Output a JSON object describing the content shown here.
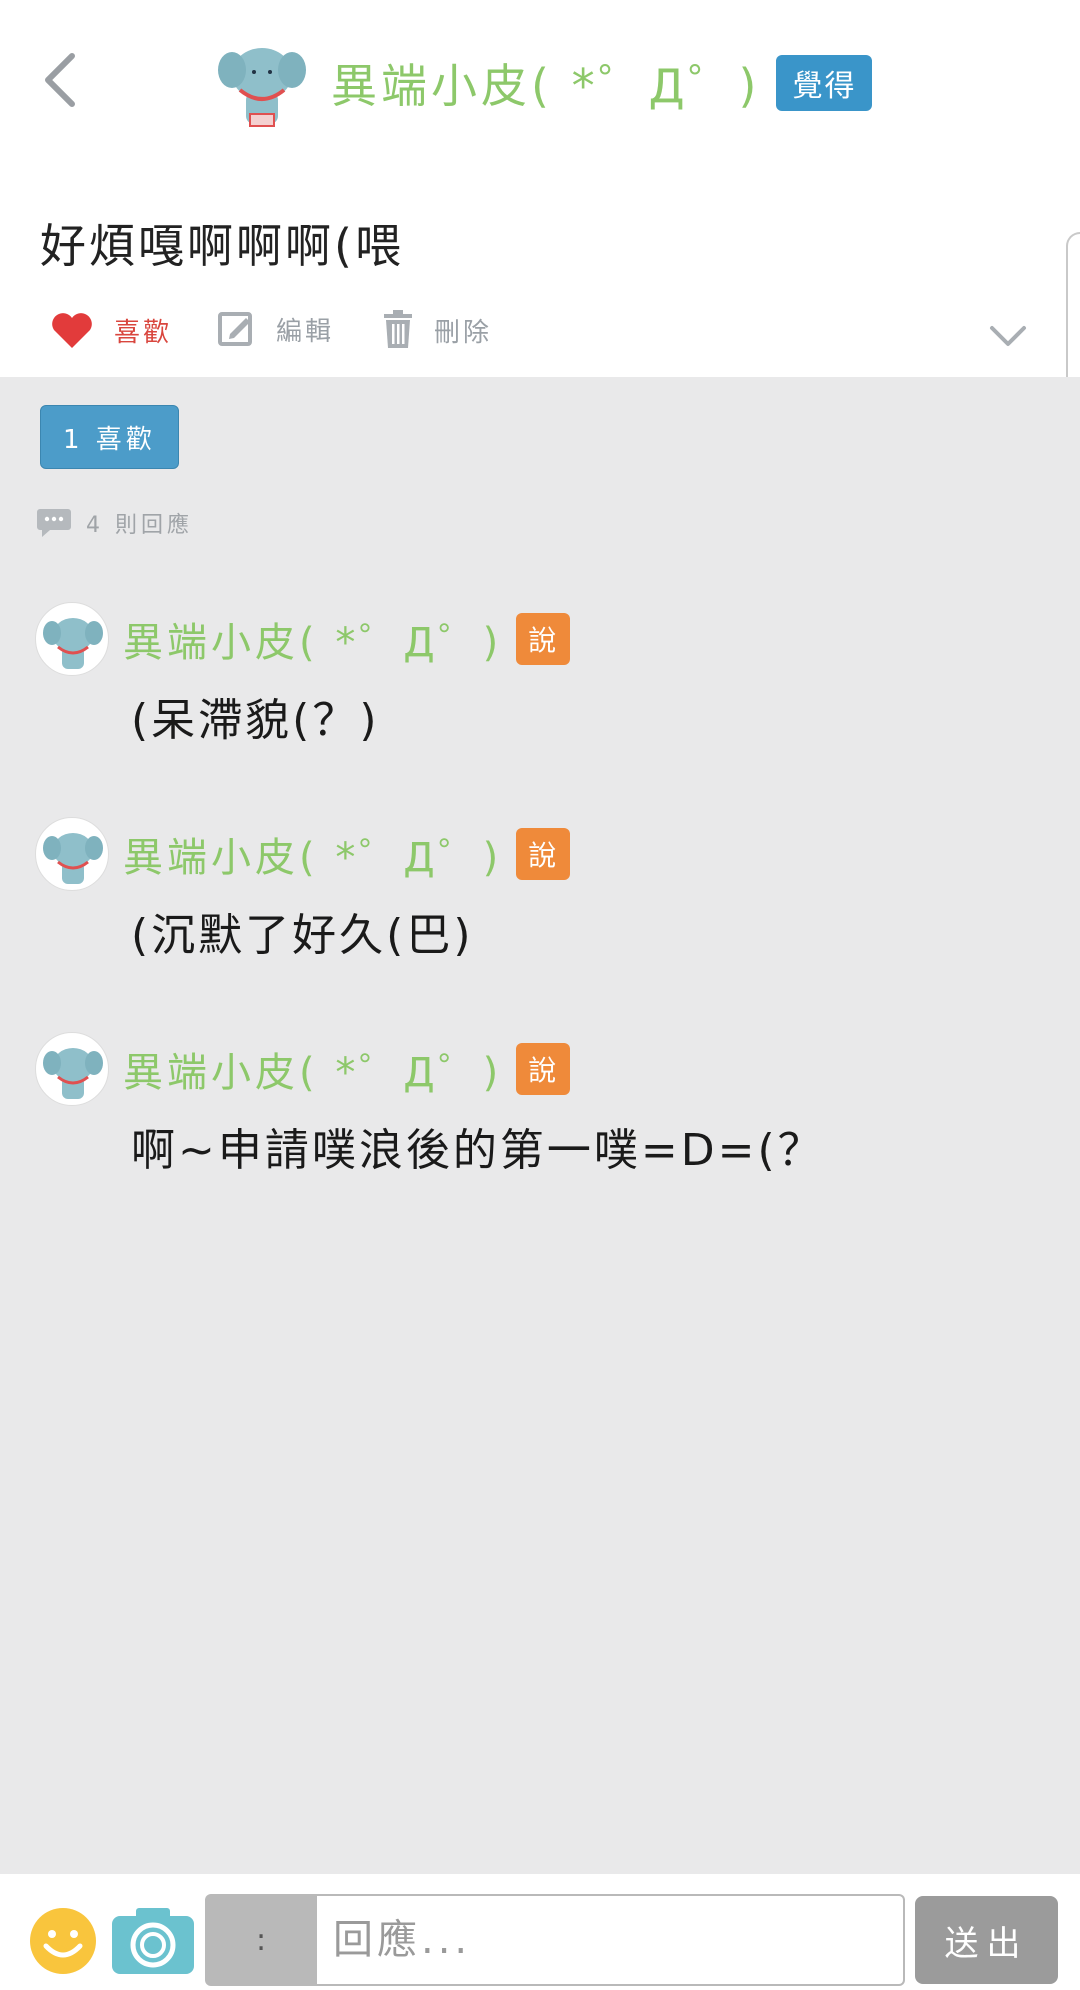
{
  "plurk": {
    "author": "異端小皮( *゜Д゜)",
    "qualifier": "覺得",
    "content": "好煩嘎啊啊啊(喂"
  },
  "actions": {
    "like": "喜歡",
    "edit": "編輯",
    "delete": "刪除"
  },
  "stats": {
    "like_count": "1 喜歡",
    "response_count": "4 則回應"
  },
  "responses": [
    {
      "author": "異端小皮( *゜Д゜)",
      "qualifier": "說",
      "text": "(呆滯貌(？)"
    },
    {
      "author": "異端小皮( *゜Д゜)",
      "qualifier": "說",
      "text": "(沉默了好久(巴)"
    },
    {
      "author": "異端小皮( *゜Д゜)",
      "qualifier": "說",
      "text": "啊~申請噗浪後的第一噗=D=(？"
    }
  ],
  "reply_bar": {
    "qualifier": ":",
    "placeholder": "回應...",
    "send": "送出"
  },
  "colors": {
    "author_green": "#8dc86a",
    "qualifier_blue": "#3a95c9",
    "qualifier_orange": "#ef8a3a",
    "like_red": "#d9463e",
    "background_gray": "#e9e9ea"
  },
  "icons": [
    "back-arrow-icon",
    "heart-icon",
    "edit-icon",
    "trash-icon",
    "chevron-down-icon",
    "speech-bubble-icon",
    "emoji-icon",
    "camera-icon"
  ]
}
